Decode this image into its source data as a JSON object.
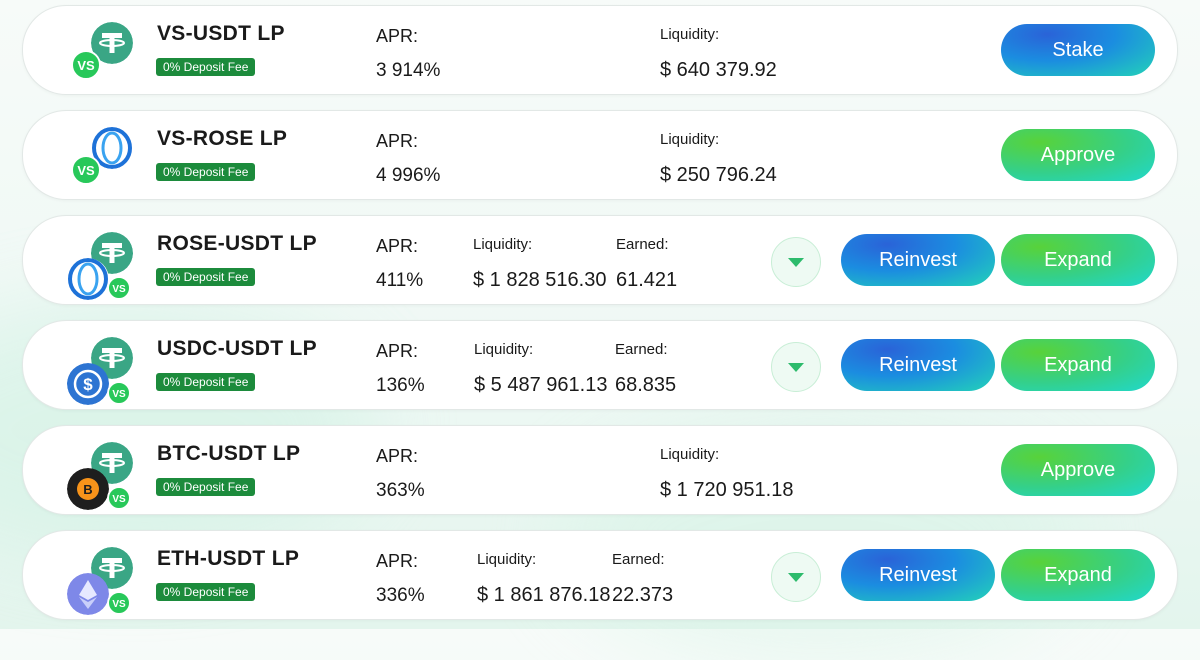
{
  "colors": {
    "fee_badge": "#1c8b3c",
    "stake_blue": "#1b8de0",
    "approve_green": "#34d08a"
  },
  "fee_label": "0% Deposit Fee",
  "apr_label": "APR:",
  "liquidity_label": "Liquidity:",
  "earned_label": "Earned:",
  "pools": [
    {
      "name": "VS-USDT LP",
      "apr": "3 914%",
      "liquidity": "$ 640 379.92",
      "earned": "",
      "primary_button": "Stake",
      "secondary_button": "",
      "icons": [
        "usdt-icon",
        "vs-icon"
      ]
    },
    {
      "name": "VS-ROSE LP",
      "apr": "4 996%",
      "liquidity": "$ 250 796.24",
      "earned": "",
      "primary_button": "Approve",
      "secondary_button": "",
      "icons": [
        "rose-icon",
        "vs-icon"
      ]
    },
    {
      "name": "ROSE-USDT LP",
      "apr": "411%",
      "liquidity": "$ 1 828 516.30",
      "earned": "61.421",
      "primary_button": "Expand",
      "secondary_button": "Reinvest",
      "icons": [
        "usdt-icon",
        "rose-icon",
        "vs-icon"
      ]
    },
    {
      "name": "USDC-USDT LP",
      "apr": "136%",
      "liquidity": "$ 5 487 961.13",
      "earned": "68.835",
      "primary_button": "Expand",
      "secondary_button": "Reinvest",
      "icons": [
        "usdt-icon",
        "usdc-icon",
        "vs-icon"
      ]
    },
    {
      "name": "BTC-USDT LP",
      "apr": "363%",
      "liquidity": "$ 1 720 951.18",
      "earned": "",
      "primary_button": "Approve",
      "secondary_button": "",
      "icons": [
        "usdt-icon",
        "btc-icon",
        "vs-icon"
      ]
    },
    {
      "name": "ETH-USDT LP",
      "apr": "336%",
      "liquidity": "$ 1 861 876.18",
      "earned": "22.373",
      "primary_button": "Expand",
      "secondary_button": "Reinvest",
      "icons": [
        "usdt-icon",
        "eth-icon",
        "vs-icon"
      ]
    }
  ]
}
